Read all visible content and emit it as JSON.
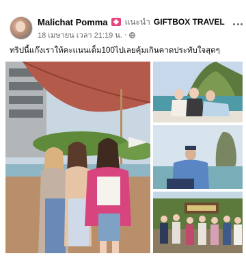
{
  "post": {
    "author": "Malichat Pomma",
    "recommend_text": "แนะนำ",
    "page_name": "GIFTBOX TRAVEL",
    "timestamp": "18 เมษายน เวลา 21:19 น.",
    "separator": "·",
    "privacy_icon": "globe-icon",
    "caption": "ทริปนี้แก๊งเราให้คะแนนเต็ม100ไปเลยคุ้มเกินคาดประทับใจสุดๆ"
  },
  "icons": {
    "badge": "badge-icon",
    "more": "more-options-icon"
  },
  "colors": {
    "text_primary": "#050505",
    "text_secondary": "#65676b",
    "badge": "#e8467e"
  },
  "photos": [
    {
      "name": "group-photo-poolside"
    },
    {
      "name": "photo-boat-group"
    },
    {
      "name": "photo-boat-man"
    },
    {
      "name": "photo-tour-group-sign"
    }
  ]
}
